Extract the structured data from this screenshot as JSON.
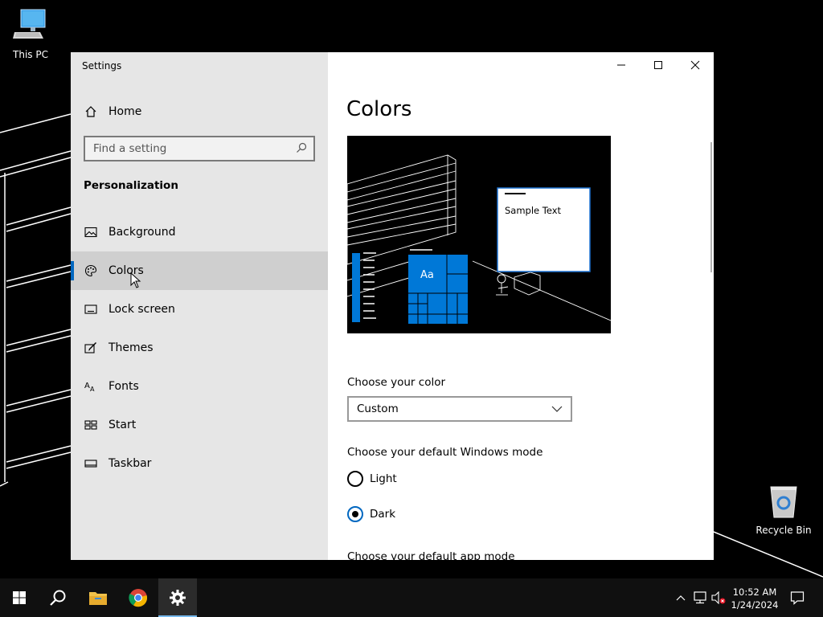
{
  "desktop": {
    "icons": [
      {
        "label": "This PC",
        "icon": "this-pc-icon"
      },
      {
        "label": "Recycle Bin",
        "icon": "recycle-bin-icon"
      }
    ]
  },
  "window": {
    "title": "Settings",
    "controls": {
      "minimize": "minimize-icon",
      "maximize": "maximize-icon",
      "close": "close-icon"
    }
  },
  "sidebar": {
    "home_label": "Home",
    "search_placeholder": "Find a setting",
    "section_heading": "Personalization",
    "items": [
      {
        "label": "Background",
        "icon": "picture-icon"
      },
      {
        "label": "Colors",
        "icon": "palette-icon",
        "selected": true
      },
      {
        "label": "Lock screen",
        "icon": "lock-screen-icon"
      },
      {
        "label": "Themes",
        "icon": "brush-icon"
      },
      {
        "label": "Fonts",
        "icon": "font-icon"
      },
      {
        "label": "Start",
        "icon": "start-layout-icon"
      },
      {
        "label": "Taskbar",
        "icon": "taskbar-icon"
      }
    ]
  },
  "content": {
    "title": "Colors",
    "preview": {
      "sample_text": "Sample Text",
      "tile_label": "Aa"
    },
    "choose_color_label": "Choose your color",
    "color_dropdown_value": "Custom",
    "windows_mode_label": "Choose your default Windows mode",
    "windows_mode_options": [
      {
        "label": "Light",
        "checked": false
      },
      {
        "label": "Dark",
        "checked": true
      }
    ],
    "app_mode_label": "Choose your default app mode"
  },
  "taskbar": {
    "apps": [
      "start-icon",
      "search-icon",
      "file-explorer-icon",
      "chrome-icon",
      "settings-icon"
    ],
    "tray": [
      "chevron-up-icon",
      "network-icon",
      "volume-muted-icon",
      "notification-icon"
    ],
    "time": "10:52 AM",
    "date": "1/24/2024"
  },
  "colors": {
    "accent": "#0067c0",
    "sidebar_bg": "#e6e6e6",
    "selected_bg": "#cfcfcf",
    "taskbar_bg": "#101010",
    "tile_blue": "#0078d7"
  }
}
